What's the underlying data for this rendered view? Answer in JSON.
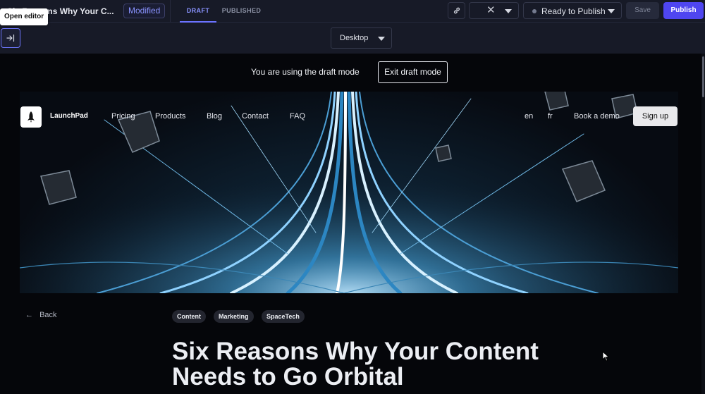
{
  "toolbar": {
    "doc_title": "Six Reasons Why Your C...",
    "modified_badge": "Modified",
    "tabs": {
      "draft": "DRAFT",
      "published": "PUBLISHED"
    },
    "locale_clear_icon": "close-icon",
    "link_icon": "link-icon",
    "status": "Ready to Publish",
    "save_label": "Save",
    "publish_label": "Publish",
    "tooltip": "Open editor"
  },
  "device": {
    "selected": "Desktop"
  },
  "preview": {
    "draft_notice": "You are using the draft mode",
    "exit_draft_label": "Exit draft mode",
    "site": {
      "brand": "LaunchPad",
      "nav": [
        "Pricing",
        "Products",
        "Blog",
        "Contact",
        "FAQ"
      ],
      "languages": [
        "en",
        "fr"
      ],
      "book_demo": "Book a demo",
      "signup": "Sign up"
    },
    "article": {
      "back_label": "Back",
      "tags": [
        "Content",
        "Marketing",
        "SpaceTech"
      ],
      "title": "Six Reasons Why Your Content Needs to Go Orbital"
    }
  },
  "colors": {
    "accent": "#4f46f0",
    "accent_text": "#8a93ff",
    "toolbar_bg": "#171a27",
    "preview_bg": "#05060a"
  }
}
